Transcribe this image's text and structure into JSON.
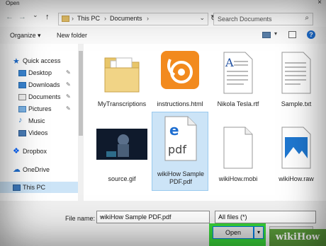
{
  "window": {
    "title": "Open",
    "close": "×"
  },
  "nav": {
    "back": "←",
    "forward": "→",
    "dropdown": "⌄",
    "up": "↑",
    "path": [
      "This PC",
      "Documents"
    ],
    "separator": "›",
    "refresh": "↻",
    "search_placeholder": "Search Documents"
  },
  "toolbar": {
    "organize": "Organize ▾",
    "new_folder": "New folder",
    "view_dropdown": "▾",
    "help": "?"
  },
  "sidebar": {
    "items": [
      {
        "label": "Quick access",
        "icon": "star-icon"
      },
      {
        "label": "Desktop",
        "icon": "desktop-folder-icon",
        "pinned": "✎"
      },
      {
        "label": "Downloads",
        "icon": "downloads-folder-icon",
        "pinned": "✎"
      },
      {
        "label": "Documents",
        "icon": "documents-folder-icon",
        "pinned": "✎"
      },
      {
        "label": "Pictures",
        "icon": "pictures-folder-icon",
        "pinned": "✎"
      },
      {
        "label": "Music",
        "icon": "music-icon"
      },
      {
        "label": "Videos",
        "icon": "videos-icon"
      },
      {
        "label": "Dropbox",
        "icon": "dropbox-icon"
      },
      {
        "label": "OneDrive",
        "icon": "onedrive-icon"
      },
      {
        "label": "This PC",
        "icon": "this-pc-icon"
      }
    ]
  },
  "files": [
    {
      "name": "MyTranscriptions",
      "type": "folder"
    },
    {
      "name": "instructions.html",
      "type": "html"
    },
    {
      "name": "Nikola Tesla.rtf",
      "type": "rtf"
    },
    {
      "name": "Sample.txt",
      "type": "txt"
    },
    {
      "name": "source.gif",
      "type": "gif"
    },
    {
      "name": "wikiHow Sample PDF.pdf",
      "type": "pdf",
      "thumb_text": "pdf"
    },
    {
      "name": "wikiHow.mobi",
      "type": "mobi"
    },
    {
      "name": "wikiHow.raw",
      "type": "raw"
    }
  ],
  "footer": {
    "filename_label": "File name:",
    "filename_value": "wikiHow Sample PDF.pdf",
    "filetype_value": "All files (*)",
    "open_label": "Open",
    "open_arrow": "▾",
    "dropdown_arrow": "⌄"
  },
  "watermark": "wikiHow",
  "colors": {
    "selection": "#cce4f7",
    "highlight": "#39d339",
    "accent": "#0078d7"
  }
}
